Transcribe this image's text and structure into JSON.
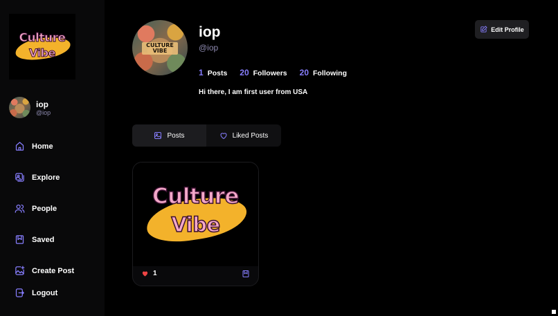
{
  "brand": {
    "word1": "Culture",
    "word2": "Vibe"
  },
  "avatar": {
    "label_line1": "CULTURE",
    "label_line2": "VIBE"
  },
  "sidebar": {
    "user": {
      "name": "iop",
      "handle": "@iop"
    },
    "nav": [
      {
        "label": "Home",
        "icon": "home-icon"
      },
      {
        "label": "Explore",
        "icon": "explore-icon"
      },
      {
        "label": "People",
        "icon": "people-icon"
      },
      {
        "label": "Saved",
        "icon": "bookmark-icon"
      },
      {
        "label": "Create Post",
        "icon": "image-plus-icon"
      }
    ],
    "logout": {
      "label": "Logout",
      "icon": "logout-icon"
    }
  },
  "profile": {
    "name": "iop",
    "handle": "@iop",
    "stats": [
      {
        "value": "1",
        "label": "Posts"
      },
      {
        "value": "20",
        "label": "Followers"
      },
      {
        "value": "20",
        "label": "Following"
      }
    ],
    "bio": "Hi there, I am first user from USA",
    "edit_label": "Edit Profile"
  },
  "tabs": [
    {
      "label": "Posts",
      "active": true
    },
    {
      "label": "Liked Posts",
      "active": false
    }
  ],
  "posts": [
    {
      "likes": "1",
      "image_word1": "Culture",
      "image_word2": "Vibe"
    }
  ],
  "colors": {
    "accent": "#877eff",
    "brand_yellow": "#f3b22b",
    "brand_pink": "#f3a7c9",
    "like_red": "#ef4444"
  }
}
